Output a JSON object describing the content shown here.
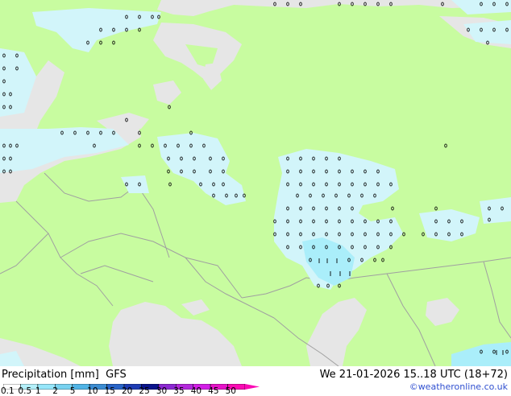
{
  "legend": {
    "title": "Precipitation [mm]",
    "model": "GFS",
    "ticks": [
      "0.1",
      "0.5",
      "1",
      "2",
      "5",
      "10",
      "15",
      "20",
      "25",
      "30",
      "35",
      "40",
      "45",
      "50"
    ],
    "colors": [
      "#ffffff",
      "#b4f0fa",
      "#96e6fa",
      "#78d2f0",
      "#50b4e6",
      "#3c8cd2",
      "#2864c8",
      "#1e3cb4",
      "#0a148c",
      "#8c28d2",
      "#b428dc",
      "#d21ee6",
      "#e614c8",
      "#fa0ab4"
    ]
  },
  "valid_time": "We 21-01-2026 15..18 UTC (18+72)",
  "credit": "©weatheronline.co.uk",
  "map": {
    "land_color": "#c8fca0",
    "sea_color": "#e6e6e6",
    "precip_light_color": "#d2f5fa",
    "precip_medium_color": "#aaeefa",
    "border_color": "#a0a0a0"
  }
}
